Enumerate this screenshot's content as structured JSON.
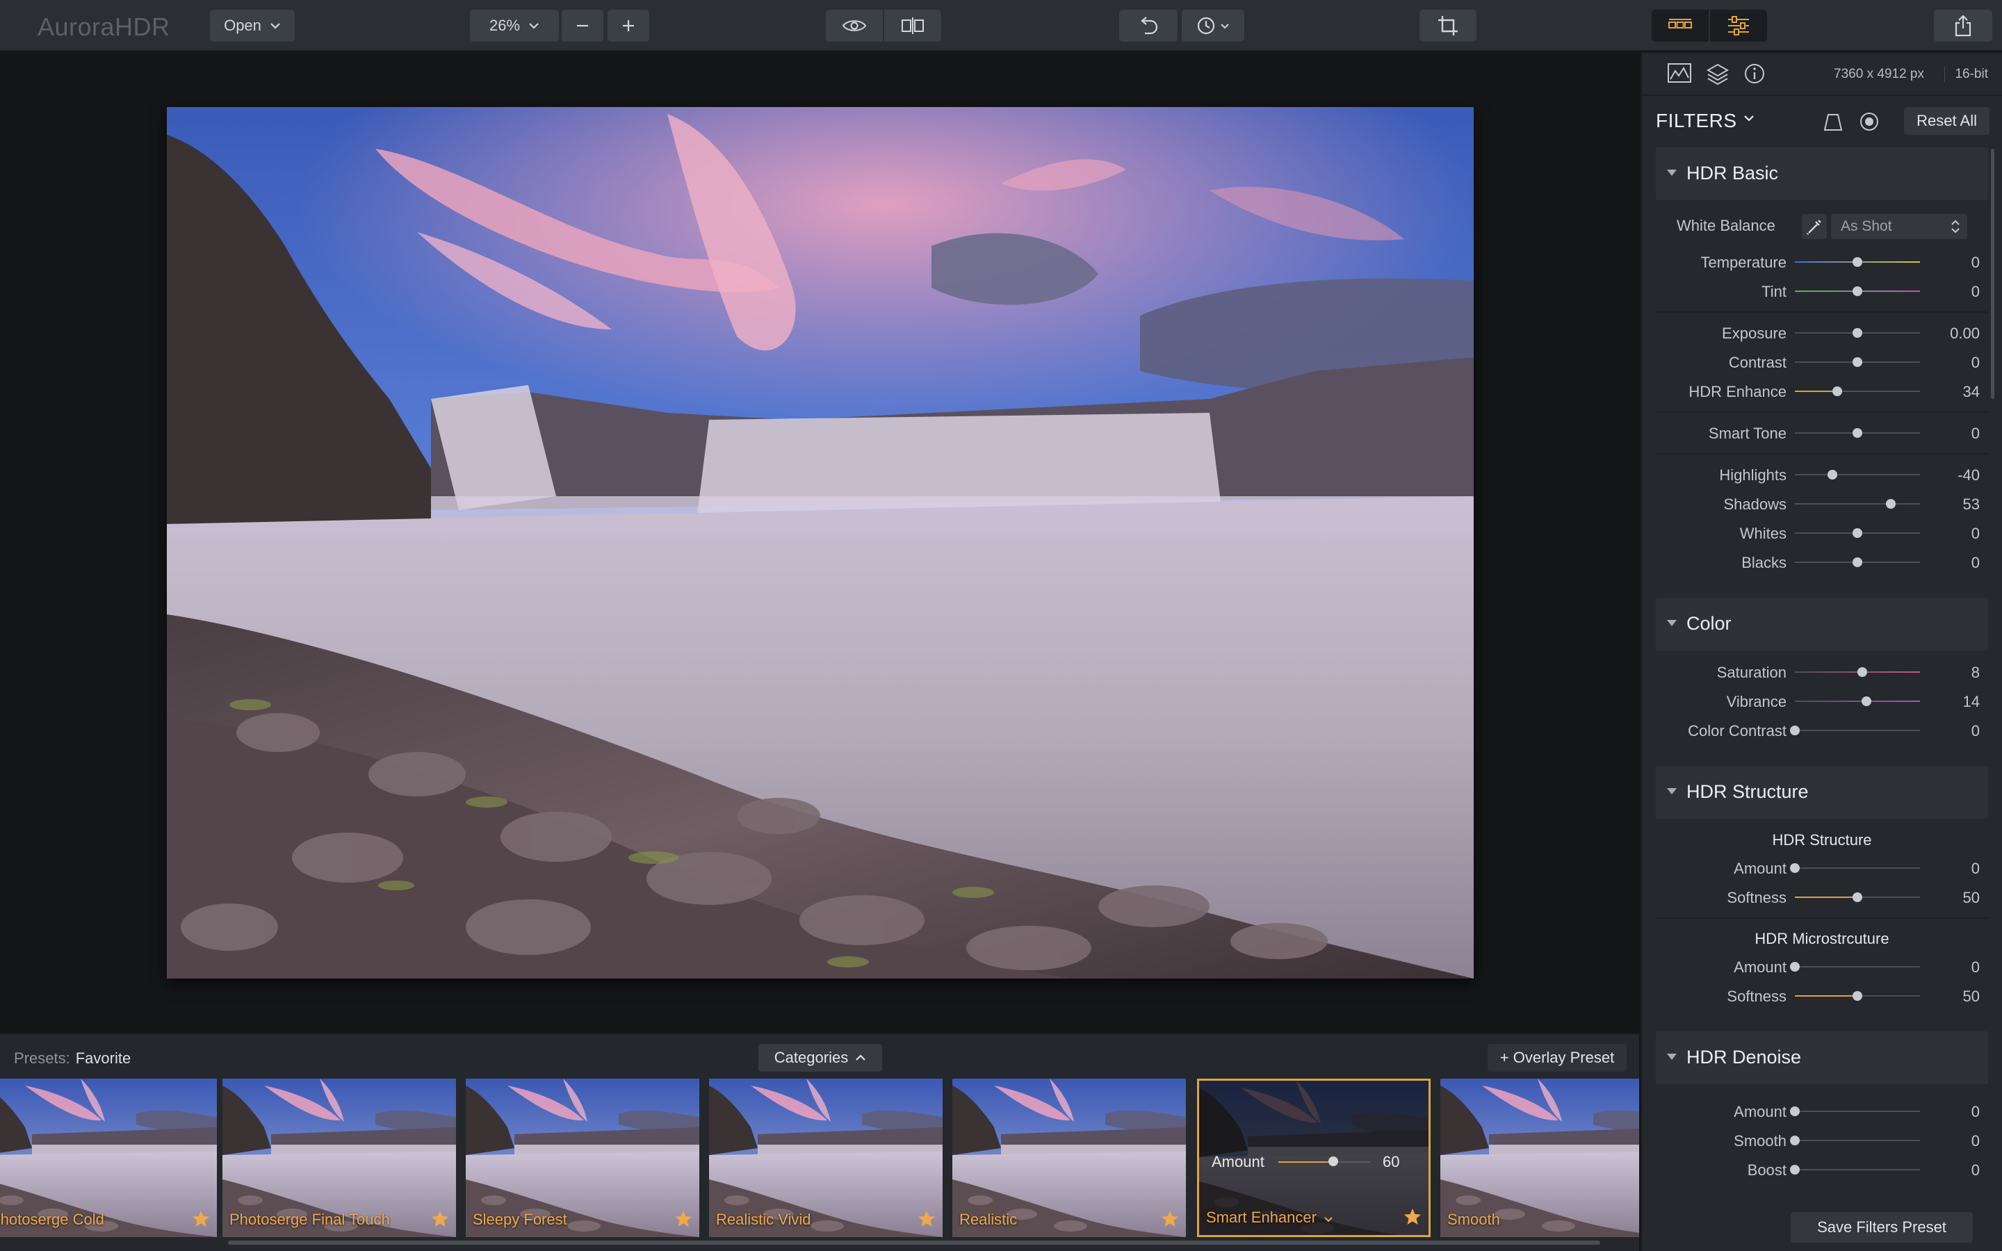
{
  "app": {
    "logo": "AuroraHDR",
    "open_label": "Open",
    "zoom": "26%",
    "zoom_out": "—",
    "zoom_in": "+"
  },
  "info": {
    "dimensions": "7360 x 4912 px",
    "bitdepth": "16-bit"
  },
  "filters": {
    "title": "FILTERS",
    "reset_label": "Reset All",
    "save_label": "Save Filters Preset",
    "sections": {
      "hdr_basic": {
        "title": "HDR Basic",
        "white_balance_label": "White Balance",
        "white_balance_value": "As Shot",
        "sliders": [
          {
            "label": "Temperature",
            "value": "0",
            "pos": 0.5,
            "track": "temp"
          },
          {
            "label": "Tint",
            "value": "0",
            "pos": 0.5,
            "track": "tint"
          },
          {
            "label": "Exposure",
            "value": "0.00",
            "pos": 0.5
          },
          {
            "label": "Contrast",
            "value": "0",
            "pos": 0.5
          },
          {
            "label": "HDR Enhance",
            "value": "34",
            "pos": 0.34,
            "fill_from": 0
          },
          {
            "label": "Smart Tone",
            "value": "0",
            "pos": 0.5
          },
          {
            "label": "Highlights",
            "value": "-40",
            "pos": 0.3
          },
          {
            "label": "Shadows",
            "value": "53",
            "pos": 0.765
          },
          {
            "label": "Whites",
            "value": "0",
            "pos": 0.5
          },
          {
            "label": "Blacks",
            "value": "0",
            "pos": 0.5
          }
        ]
      },
      "color": {
        "title": "Color",
        "sliders": [
          {
            "label": "Saturation",
            "value": "8",
            "pos": 0.54,
            "track": "sat"
          },
          {
            "label": "Vibrance",
            "value": "14",
            "pos": 0.57,
            "track": "vib"
          },
          {
            "label": "Color Contrast",
            "value": "0",
            "pos": 0.0
          }
        ]
      },
      "hdr_structure": {
        "title": "HDR Structure",
        "sub1": "HDR Structure",
        "sub2": "HDR Microstrcuture",
        "sliders1": [
          {
            "label": "Amount",
            "value": "0",
            "pos": 0.0
          },
          {
            "label": "Softness",
            "value": "50",
            "pos": 0.5,
            "fill_from": 0
          }
        ],
        "sliders2": [
          {
            "label": "Amount",
            "value": "0",
            "pos": 0.0
          },
          {
            "label": "Softness",
            "value": "50",
            "pos": 0.5,
            "fill_from": 0
          }
        ]
      },
      "hdr_denoise": {
        "title": "HDR Denoise",
        "sliders": [
          {
            "label": "Amount",
            "value": "0",
            "pos": 0.0
          },
          {
            "label": "Smooth",
            "value": "0",
            "pos": 0.0
          },
          {
            "label": "Boost",
            "value": "0",
            "pos": 0.0
          }
        ]
      }
    }
  },
  "presets": {
    "label": "Presets:",
    "group": "Favorite",
    "categories_label": "Categories",
    "overlay_label": "+ Overlay Preset",
    "items": [
      {
        "name": "Photoserge Cold"
      },
      {
        "name": "Photoserge Final Touch"
      },
      {
        "name": "Sleepy Forest"
      },
      {
        "name": "Realistic Vivid"
      },
      {
        "name": "Realistic"
      },
      {
        "name": "Smart Enhancer",
        "selected": true,
        "amount_label": "Amount",
        "amount_value": "60",
        "amount": 0.6
      },
      {
        "name": "Smooth"
      }
    ]
  },
  "colors": {
    "accent": "#e0a43c",
    "panel": "#25282c",
    "toolbar": "#2b2e33"
  }
}
